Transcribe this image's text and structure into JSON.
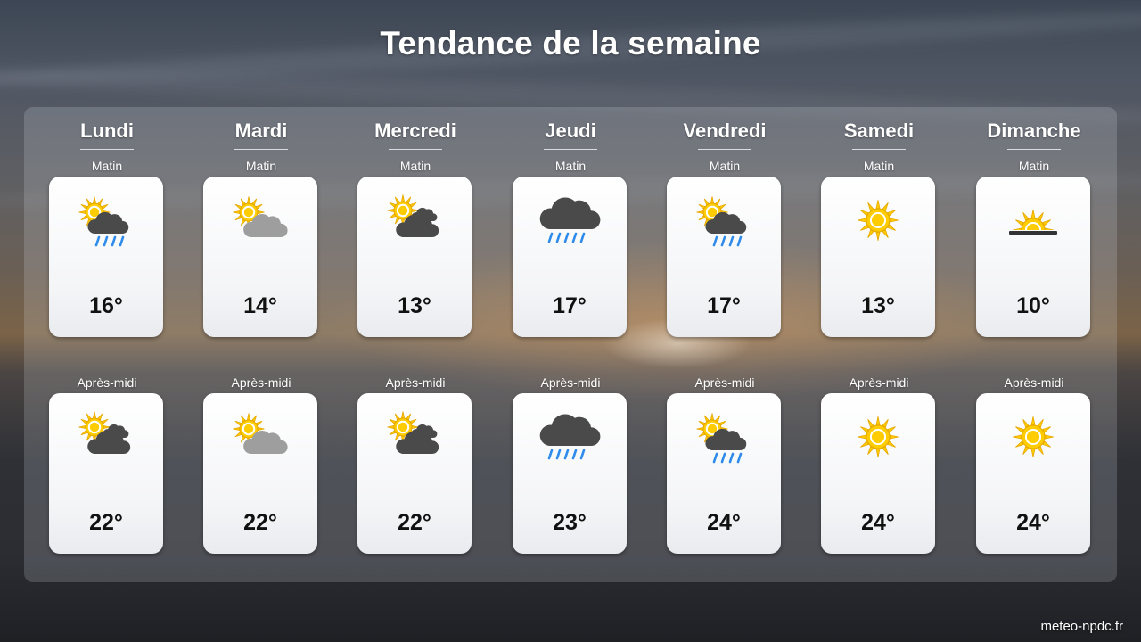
{
  "title": "Tendance de la semaine",
  "footer": "meteo-npdc.fr",
  "colors": {
    "sun": "#FFCC00",
    "sun_outline": "#E6A800",
    "cloud_dark": "#4a4a4a",
    "cloud_light": "#9e9e9e",
    "rain": "#2E8BEA"
  },
  "days": [
    {
      "name": "Lundi",
      "morning": {
        "label": "Matin",
        "icon": "sun-cloud-rain-icon",
        "temp": "16°"
      },
      "afternoon": {
        "label": "Après-midi",
        "icon": "sun-dark-clouds-icon",
        "temp": "22°"
      }
    },
    {
      "name": "Mardi",
      "morning": {
        "label": "Matin",
        "icon": "sun-light-cloud-icon",
        "temp": "14°"
      },
      "afternoon": {
        "label": "Après-midi",
        "icon": "sun-light-cloud-icon",
        "temp": "22°"
      }
    },
    {
      "name": "Mercredi",
      "morning": {
        "label": "Matin",
        "icon": "sun-dark-clouds-icon",
        "temp": "13°"
      },
      "afternoon": {
        "label": "Après-midi",
        "icon": "sun-dark-clouds-icon",
        "temp": "22°"
      }
    },
    {
      "name": "Jeudi",
      "morning": {
        "label": "Matin",
        "icon": "rain-cloud-icon",
        "temp": "17°"
      },
      "afternoon": {
        "label": "Après-midi",
        "icon": "rain-cloud-icon",
        "temp": "23°"
      }
    },
    {
      "name": "Vendredi",
      "morning": {
        "label": "Matin",
        "icon": "sun-cloud-rain-icon",
        "temp": "17°"
      },
      "afternoon": {
        "label": "Après-midi",
        "icon": "sun-cloud-rain-icon",
        "temp": "24°"
      }
    },
    {
      "name": "Samedi",
      "morning": {
        "label": "Matin",
        "icon": "sun-icon",
        "temp": "13°"
      },
      "afternoon": {
        "label": "Après-midi",
        "icon": "sun-icon",
        "temp": "24°"
      }
    },
    {
      "name": "Dimanche",
      "morning": {
        "label": "Matin",
        "icon": "sunrise-icon",
        "temp": "10°"
      },
      "afternoon": {
        "label": "Après-midi",
        "icon": "sun-icon",
        "temp": "24°"
      }
    }
  ]
}
